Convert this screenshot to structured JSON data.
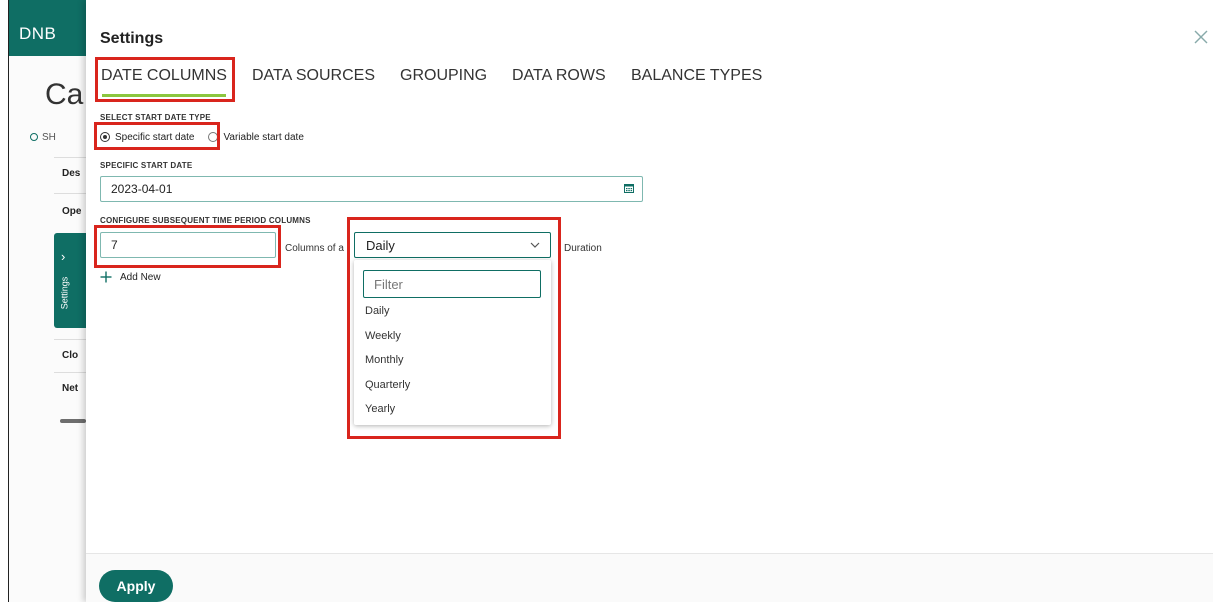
{
  "app": {
    "logo": "DNB",
    "page_title_partial": "Ca",
    "subtitle_partial": "SH",
    "bg_labels": [
      "Des",
      "Ope",
      "Clo",
      "Net"
    ],
    "side_tab_label": "Settings",
    "brand_color": "#0f6e64",
    "accent_color": "#8cc63f"
  },
  "panel": {
    "title": "Settings",
    "tabs": [
      {
        "label": "DATE COLUMNS",
        "active": true
      },
      {
        "label": "DATA SOURCES",
        "active": false
      },
      {
        "label": "GROUPING",
        "active": false
      },
      {
        "label": "DATA ROWS",
        "active": false
      },
      {
        "label": "BALANCE TYPES",
        "active": false
      }
    ],
    "start_date_type": {
      "label": "SELECT START DATE TYPE",
      "options": [
        {
          "label": "Specific start date",
          "checked": true
        },
        {
          "label": "Variable start date",
          "checked": false
        }
      ]
    },
    "specific_start_date": {
      "label": "SPECIFIC START DATE",
      "value": "2023-04-01"
    },
    "subsequent_columns": {
      "label": "CONFIGURE SUBSEQUENT TIME PERIOD COLUMNS",
      "count": "7",
      "text_between": "Columns of a",
      "duration_selected": "Daily",
      "text_after": "Duration",
      "filter_placeholder": "Filter",
      "options": [
        "Daily",
        "Weekly",
        "Monthly",
        "Quarterly",
        "Yearly"
      ]
    },
    "add_new_label": "Add New",
    "apply_label": "Apply"
  }
}
